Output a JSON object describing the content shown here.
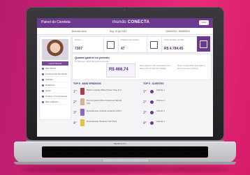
{
  "app": {
    "title": "Painel do Cientista",
    "brand_prefix": "mundo",
    "brand_name": "CONECTA",
    "logout_label": "SAIR"
  },
  "subbar": {
    "user_text": "Bom dia Laura",
    "date_text": "Seg, 10 jun 2024",
    "right_text": "10/06/2024 - 30/06/2024"
  },
  "stats": [
    {
      "label": "Pontos",
      "value": "7307"
    },
    {
      "label": "Pedidos Aprovados",
      "value": "47"
    },
    {
      "label": "Total Vendido no Mês",
      "value": "R$ 4.784,45"
    }
  ],
  "sidebar": {
    "profile_name": "Laura Oliveira",
    "items": [
      {
        "label": "Meu Painel"
      },
      {
        "label": "Ferramentas de Venda"
      },
      {
        "label": "Pedidos"
      },
      {
        "label": "Relatórios"
      },
      {
        "label": "Ajuda"
      },
      {
        "label": "Cursos e Treinamentos"
      },
      {
        "label": "Meu Cadastro"
      }
    ]
  },
  "earnings": {
    "title": "Quanto ganhei no período",
    "subtitle": "Confira seu saldo de ganhos do mês",
    "value": "R$ 466,74",
    "note": "Seus ganhos são calculados com base nas vendas aprovadas",
    "tip": "Dica: compartilhe seus links e aumente seus ganhos."
  },
  "top_products": {
    "heading": "TOP 5 - MAIS VENDIDOS",
    "items": [
      {
        "rank": "1°",
        "name": "Batom Líquido Matte Power Stay 4ml"
      },
      {
        "rank": "2°",
        "name": "Pó Compacto Ultra Cobertura Natural 10g"
      },
      {
        "rank": "3°",
        "name": "Desodorante Colônia Lavanda 100ml"
      },
      {
        "rank": "4°",
        "name": "Desodorante Perfume Tutti 75ml"
      }
    ]
  },
  "top_clients": {
    "heading": "TOP 5 - CLIENTES",
    "items": [
      {
        "rank": "1°",
        "name": "Cliente 1"
      },
      {
        "rank": "2°",
        "name": "Cliente 2"
      },
      {
        "rank": "3°",
        "name": "Cliente 3"
      },
      {
        "rank": "4°",
        "name": "Cliente 4"
      }
    ]
  },
  "laptop": {
    "model_label": "MacBook Pro"
  },
  "colors": {
    "background": "#d61f72",
    "brand_purple": "#6b3a8f"
  }
}
